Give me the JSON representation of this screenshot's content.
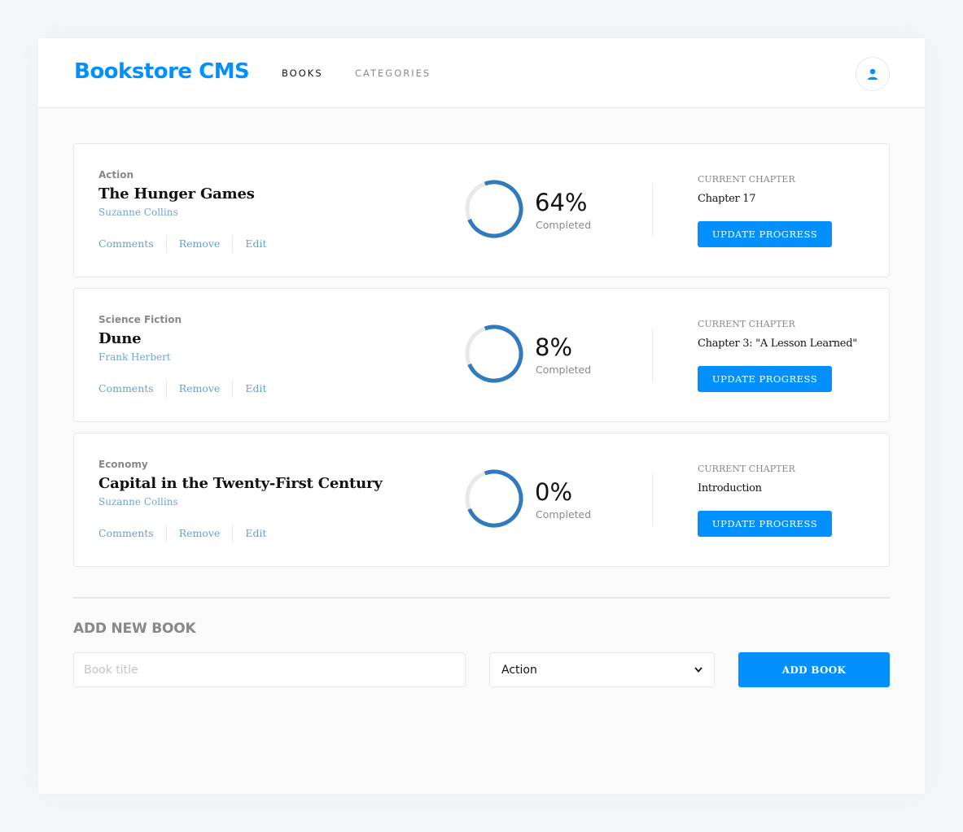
{
  "header": {
    "logo": "Bookstore CMS",
    "nav": [
      "BOOKS",
      "CATEGORIES"
    ],
    "user_icon": "user-icon"
  },
  "books": [
    {
      "genre": "Action",
      "title": "The Hunger Games",
      "author": "Suzanne Collins",
      "actions": [
        "Comments",
        "Remove",
        "Edit"
      ],
      "progress_percent": 64,
      "percent_label": "64%",
      "completed_label": "Completed",
      "chapter_label": "CURRENT CHAPTER",
      "chapter": "Chapter 17",
      "update_label": "UPDATE PROGRESS"
    },
    {
      "genre": "Science Fiction",
      "title": "Dune",
      "author": "Frank Herbert",
      "actions": [
        "Comments",
        "Remove",
        "Edit"
      ],
      "progress_percent": 8,
      "percent_label": "8%",
      "completed_label": "Completed",
      "chapter_label": "CURRENT CHAPTER",
      "chapter": "Chapter 3: \"A Lesson Learned\"",
      "update_label": "UPDATE PROGRESS"
    },
    {
      "genre": "Economy",
      "title": "Capital in the Twenty-First Century",
      "author": "Suzanne Collins",
      "actions": [
        "Comments",
        "Remove",
        "Edit"
      ],
      "progress_percent": 0,
      "percent_label": "0%",
      "completed_label": "Completed",
      "chapter_label": "CURRENT CHAPTER",
      "chapter": "Introduction",
      "update_label": "UPDATE PROGRESS"
    }
  ],
  "form": {
    "title": "ADD NEW BOOK",
    "title_placeholder": "Book title",
    "category_selected": "Action",
    "submit_label": "ADD BOOK"
  },
  "colors": {
    "accent": "#0290ff",
    "progress": "#307bbe",
    "track": "#e8e8e8"
  }
}
